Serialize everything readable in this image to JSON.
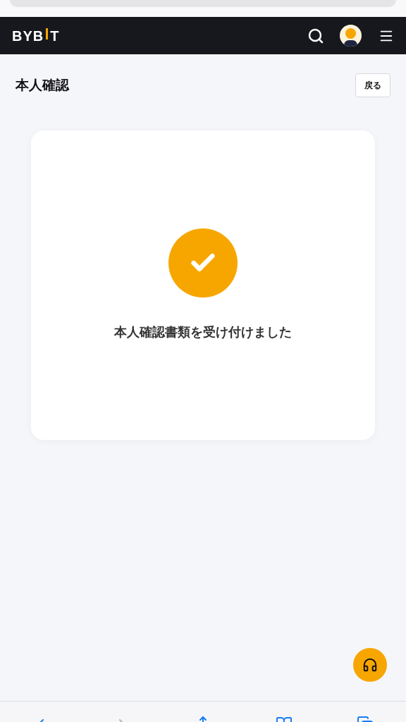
{
  "header": {
    "logo_parts": [
      "BYB",
      "T"
    ]
  },
  "page": {
    "title": "本人確認",
    "back_button": "戻る"
  },
  "card": {
    "kind": "success",
    "message": "本人確認書類を受け付けました"
  }
}
